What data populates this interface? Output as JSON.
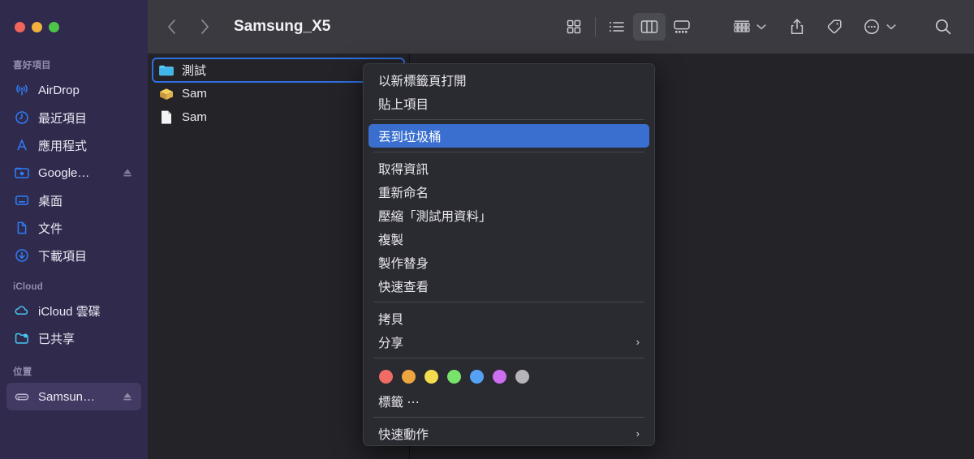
{
  "window": {
    "title": "Samsung_X5",
    "traffic_lights": [
      {
        "name": "close",
        "color": "#f2655a"
      },
      {
        "name": "minimize",
        "color": "#f2b03c"
      },
      {
        "name": "zoom",
        "color": "#4ec44b"
      }
    ]
  },
  "toolbar": {
    "back_label": "‹",
    "forward_label": "›",
    "buttons": [
      {
        "name": "icon-view",
        "label": "icon-view-icon"
      },
      {
        "name": "list-view",
        "label": "list-view-icon"
      },
      {
        "name": "column-view",
        "label": "column-view-icon",
        "active": true
      },
      {
        "name": "gallery-view",
        "label": "gallery-view-icon"
      },
      {
        "name": "group-by",
        "label": "group-by-icon"
      },
      {
        "name": "share",
        "label": "share-icon"
      },
      {
        "name": "tags",
        "label": "tag-icon"
      },
      {
        "name": "more-actions",
        "label": "more-ellipsis-icon"
      },
      {
        "name": "search",
        "label": "search-icon"
      }
    ]
  },
  "sidebar": {
    "sections": [
      {
        "title": "喜好項目",
        "items": [
          {
            "label": "AirDrop",
            "icon": "airdrop-icon",
            "eject": false
          },
          {
            "label": "最近項目",
            "icon": "clock-icon",
            "eject": false
          },
          {
            "label": "應用程式",
            "icon": "applications-icon",
            "eject": false
          },
          {
            "label": "Google…",
            "icon": "folder-drive-icon",
            "eject": true
          },
          {
            "label": "桌面",
            "icon": "desktop-icon",
            "eject": false
          },
          {
            "label": "文件",
            "icon": "document-icon",
            "eject": false
          },
          {
            "label": "下載項目",
            "icon": "download-icon",
            "eject": false
          }
        ]
      },
      {
        "title": "iCloud",
        "items": [
          {
            "label": "iCloud 雲碟",
            "icon": "cloud-icon",
            "eject": false
          },
          {
            "label": "已共享",
            "icon": "shared-folder-icon",
            "eject": false
          }
        ]
      },
      {
        "title": "位置",
        "items": [
          {
            "label": "Samsun…",
            "icon": "external-drive-icon",
            "eject": true,
            "selected": true
          }
        ]
      }
    ]
  },
  "file_list": [
    {
      "name": "測試",
      "icon": "folder-icon",
      "selected": true
    },
    {
      "name": "Sam",
      "icon": "package-icon",
      "selected": false
    },
    {
      "name": "Sam",
      "icon": "document-file-icon",
      "selected": false
    }
  ],
  "context_menu": {
    "groups": [
      {
        "items": [
          {
            "label": "以新標籤頁打開",
            "submenu": false,
            "highlight": false
          },
          {
            "label": "貼上項目",
            "submenu": false,
            "highlight": false
          }
        ]
      },
      {
        "items": [
          {
            "label": "丟到垃圾桶",
            "submenu": false,
            "highlight": true
          }
        ]
      },
      {
        "items": [
          {
            "label": "取得資訊",
            "submenu": false,
            "highlight": false
          },
          {
            "label": "重新命名",
            "submenu": false,
            "highlight": false
          },
          {
            "label": "壓縮「測試用資料」",
            "submenu": false,
            "highlight": false
          },
          {
            "label": "複製",
            "submenu": false,
            "highlight": false
          },
          {
            "label": "製作替身",
            "submenu": false,
            "highlight": false
          },
          {
            "label": "快速查看",
            "submenu": false,
            "highlight": false
          }
        ]
      },
      {
        "items": [
          {
            "label": "拷貝",
            "submenu": false,
            "highlight": false
          },
          {
            "label": "分享",
            "submenu": true,
            "highlight": false
          }
        ]
      },
      {
        "tags": [
          "#ef6b63",
          "#eda53f",
          "#f5dc4e",
          "#78e36a",
          "#55a2f5",
          "#cc6ef0",
          "#b4b4b9"
        ],
        "items": [
          {
            "label": "標籤 ⋯",
            "submenu": false,
            "highlight": false
          }
        ]
      },
      {
        "items": [
          {
            "label": "快速動作",
            "submenu": true,
            "highlight": false
          }
        ]
      }
    ],
    "submenu_arrow": "›"
  },
  "colors": {
    "sidebar_bg": "#302a4d",
    "toolbar_bg": "#3a3a40",
    "content_bg": "#232328",
    "menu_bg": "#2a2a31",
    "accent_highlight": "#3a6fd0",
    "selection_outline": "#2f6fe0",
    "sidebar_accent": "#2f7cf6"
  }
}
